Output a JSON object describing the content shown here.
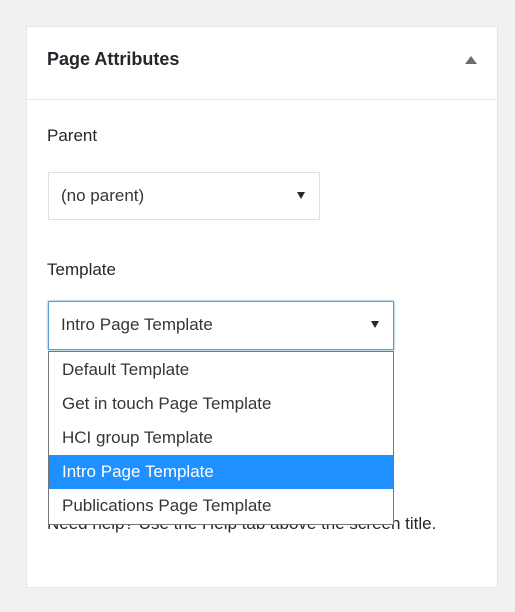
{
  "panel": {
    "title": "Page Attributes",
    "toggle_icon": "triangle-up-icon"
  },
  "parent": {
    "label": "Parent",
    "selected": "(no parent)"
  },
  "template": {
    "label": "Template",
    "selected": "Intro Page Template",
    "options": [
      "Default Template",
      "Get in touch Page Template",
      "HCI group Template",
      "Intro Page Template",
      "Publications Page Template"
    ],
    "highlighted_index": 3
  },
  "help": {
    "text": "Need help? Use the Help tab above the screen title."
  },
  "colors": {
    "highlight": "#1e90ff",
    "focus_border": "#5b9dd9"
  }
}
